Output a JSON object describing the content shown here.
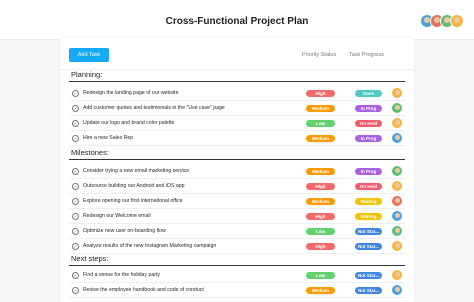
{
  "header": {
    "title": "Cross-Functional Project Plan",
    "avatar_colors": [
      "#4aa3df",
      "#e86f5a",
      "#5bbf7a",
      "#f5b53f"
    ]
  },
  "toolbar": {
    "add_task_label": "Add Task",
    "col_priority": "Priority Status",
    "col_progress": "Task Progress"
  },
  "colors": {
    "High": "#f06a6a",
    "Medium": "#fd9a00",
    "Low": "#62d26f",
    "Done": "#4ecbc4",
    "In Prog": "#aa62e3",
    "On Hold": "#f15c6c",
    "Waiting": "#eec300",
    "Not Started": "#4186e0"
  },
  "sections": [
    {
      "title": "Planning:",
      "tasks": [
        {
          "name": "Redesign the landing page of our website",
          "priority": "High",
          "progress": "Done",
          "avatar": "#f5b53f"
        },
        {
          "name": "Add customer quotes and testimonials in the \"Use case\" page",
          "priority": "Medium",
          "progress": "In Prog",
          "avatar": "#5bbf7a"
        },
        {
          "name": "Update our logo and brand color palette",
          "priority": "Low",
          "progress": "On Hold",
          "avatar": "#f5b53f"
        },
        {
          "name": "Hire a new Sales Rep",
          "priority": "Medium",
          "progress": "In Prog",
          "avatar": "#4aa3df"
        }
      ]
    },
    {
      "title": "Milestones:",
      "tasks": [
        {
          "name": "Consider trying a new email marketing service",
          "priority": "Medium",
          "progress": "In Prog",
          "avatar": "#5bbf7a"
        },
        {
          "name": "Outsource building our Android and iOS app",
          "priority": "High",
          "progress": "On Hold",
          "avatar": "#f5b53f"
        },
        {
          "name": "Explore opening our first international office",
          "priority": "Medium",
          "progress": "Waiting",
          "avatar": "#e86f5a"
        },
        {
          "name": "Redesign our Welcome email",
          "priority": "High",
          "progress": "Waiting",
          "avatar": "#4aa3df"
        },
        {
          "name": "Optimize new user on-boarding flow",
          "priority": "Low",
          "progress": "Not Star...",
          "avatar": "#5bbf7a"
        },
        {
          "name": "Analyze results of the new Instagram Marketing campaign",
          "priority": "High",
          "progress": "Not Star...",
          "avatar": "#f5b53f"
        }
      ]
    },
    {
      "title": "Next steps:",
      "tasks": [
        {
          "name": "Find a venue for the holiday party",
          "priority": "Low",
          "progress": "Not Star...",
          "avatar": "#f5b53f"
        },
        {
          "name": "Revise the employee handbook and code of conduct",
          "priority": "Medium",
          "progress": "Not Star...",
          "avatar": "#4aa3df"
        }
      ]
    }
  ]
}
